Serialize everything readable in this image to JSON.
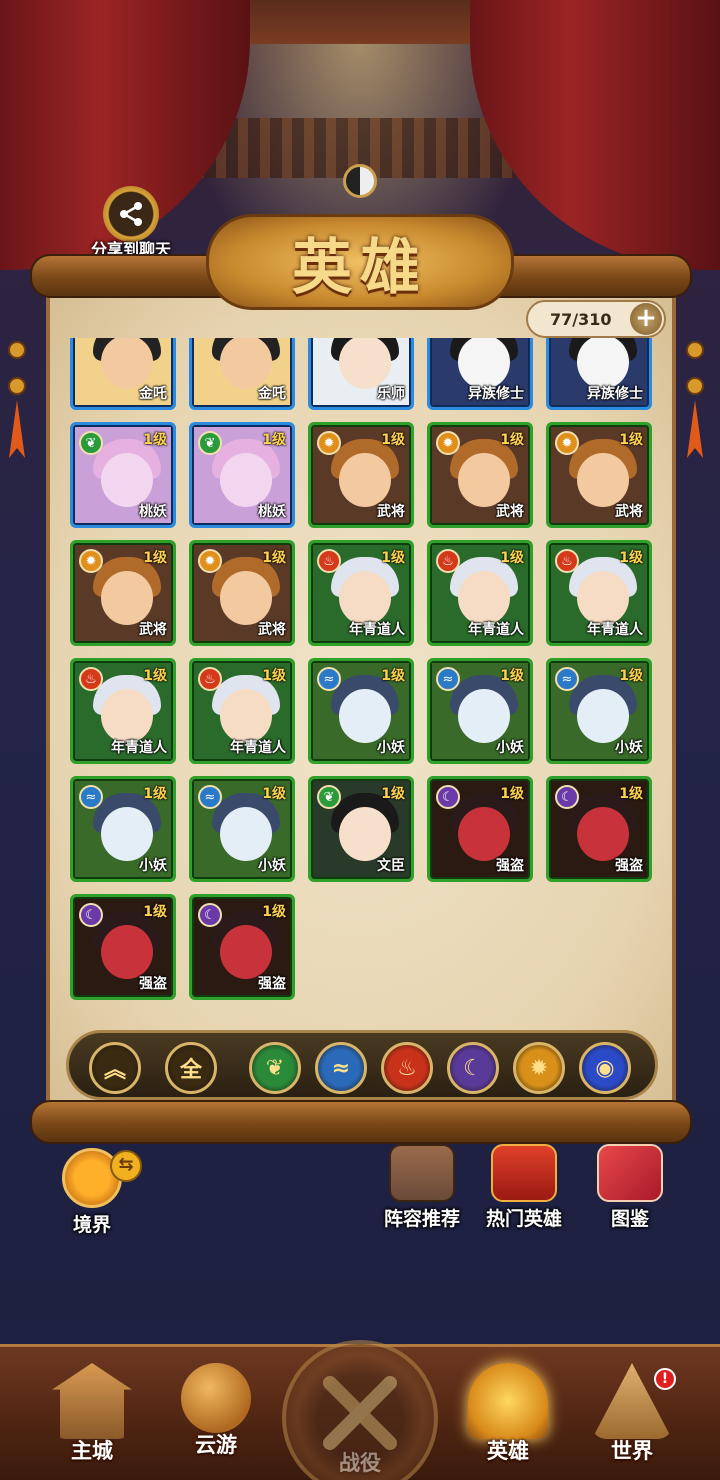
{
  "share": {
    "label": "分享到聊天"
  },
  "title": "英雄",
  "hero_count": "77/310",
  "plus_label": "+",
  "colors": {
    "green_frame": "#2fa02a",
    "blue_frame": "#2c8be0",
    "level_text": "#ffd34d"
  },
  "heroes": [
    {
      "name": "金吒",
      "level": "",
      "frame": "blue",
      "element": "none",
      "skin": "#f3c9a0",
      "hair": "#222222",
      "bg": "#f2d28a"
    },
    {
      "name": "金吒",
      "level": "",
      "frame": "blue",
      "element": "none",
      "skin": "#f3c9a0",
      "hair": "#222222",
      "bg": "#f2d28a"
    },
    {
      "name": "乐师",
      "level": "",
      "frame": "blue",
      "element": "none",
      "skin": "#f6e0cc",
      "hair": "#1a1a1a",
      "bg": "#e8eef2"
    },
    {
      "name": "异族修士",
      "level": "",
      "frame": "blue",
      "element": "none",
      "skin": "#f5f5f5",
      "hair": "#1a1a1a",
      "bg": "#2a3a6a"
    },
    {
      "name": "异族修士",
      "level": "",
      "frame": "blue",
      "element": "none",
      "skin": "#f5f5f5",
      "hair": "#1a1a1a",
      "bg": "#2a3a6a"
    },
    {
      "name": "桃妖",
      "level": "1级",
      "frame": "blue",
      "element": "wood",
      "skin": "#f2d6ef",
      "hair": "#e6b0e0",
      "bg": "#c9a0d8"
    },
    {
      "name": "桃妖",
      "level": "1级",
      "frame": "blue",
      "element": "wood",
      "skin": "#f2d6ef",
      "hair": "#e6b0e0",
      "bg": "#c9a0d8"
    },
    {
      "name": "武将",
      "level": "1级",
      "frame": "green",
      "element": "light",
      "skin": "#f3c9a0",
      "hair": "#b06a2a",
      "bg": "#5a3a26"
    },
    {
      "name": "武将",
      "level": "1级",
      "frame": "green",
      "element": "light",
      "skin": "#f3c9a0",
      "hair": "#b06a2a",
      "bg": "#5a3a26"
    },
    {
      "name": "武将",
      "level": "1级",
      "frame": "green",
      "element": "light",
      "skin": "#f3c9a0",
      "hair": "#b06a2a",
      "bg": "#5a3a26"
    },
    {
      "name": "武将",
      "level": "1级",
      "frame": "green",
      "element": "light",
      "skin": "#f3c9a0",
      "hair": "#b06a2a",
      "bg": "#5a3a26"
    },
    {
      "name": "武将",
      "level": "1级",
      "frame": "green",
      "element": "light",
      "skin": "#f3c9a0",
      "hair": "#b06a2a",
      "bg": "#5a3a26"
    },
    {
      "name": "年青道人",
      "level": "1级",
      "frame": "green",
      "element": "fire",
      "skin": "#f6dcc4",
      "hair": "#dfe4ee",
      "bg": "#2a6a2a"
    },
    {
      "name": "年青道人",
      "level": "1级",
      "frame": "green",
      "element": "fire",
      "skin": "#f6dcc4",
      "hair": "#dfe4ee",
      "bg": "#2a6a2a"
    },
    {
      "name": "年青道人",
      "level": "1级",
      "frame": "green",
      "element": "fire",
      "skin": "#f6dcc4",
      "hair": "#dfe4ee",
      "bg": "#2a6a2a"
    },
    {
      "name": "年青道人",
      "level": "1级",
      "frame": "green",
      "element": "fire",
      "skin": "#f6dcc4",
      "hair": "#dfe4ee",
      "bg": "#2a6a2a"
    },
    {
      "name": "年青道人",
      "level": "1级",
      "frame": "green",
      "element": "fire",
      "skin": "#f6dcc4",
      "hair": "#dfe4ee",
      "bg": "#2a6a2a"
    },
    {
      "name": "小妖",
      "level": "1级",
      "frame": "green",
      "element": "water",
      "skin": "#e4eef6",
      "hair": "#3a4a6a",
      "bg": "#3a6a2a"
    },
    {
      "name": "小妖",
      "level": "1级",
      "frame": "green",
      "element": "water",
      "skin": "#e4eef6",
      "hair": "#3a4a6a",
      "bg": "#3a6a2a"
    },
    {
      "name": "小妖",
      "level": "1级",
      "frame": "green",
      "element": "water",
      "skin": "#e4eef6",
      "hair": "#3a4a6a",
      "bg": "#3a6a2a"
    },
    {
      "name": "小妖",
      "level": "1级",
      "frame": "green",
      "element": "water",
      "skin": "#e4eef6",
      "hair": "#3a4a6a",
      "bg": "#3a6a2a"
    },
    {
      "name": "小妖",
      "level": "1级",
      "frame": "green",
      "element": "water",
      "skin": "#e4eef6",
      "hair": "#3a4a6a",
      "bg": "#3a6a2a"
    },
    {
      "name": "文臣",
      "level": "1级",
      "frame": "green",
      "element": "wood",
      "skin": "#f6e0cc",
      "hair": "#1a1a1a",
      "bg": "#2a3a2a"
    },
    {
      "name": "强盗",
      "level": "1级",
      "frame": "green",
      "element": "dark",
      "skin": "#c8323a",
      "hair": "#2a1a1a",
      "bg": "#2a1a12"
    },
    {
      "name": "强盗",
      "level": "1级",
      "frame": "green",
      "element": "dark",
      "skin": "#c8323a",
      "hair": "#2a1a1a",
      "bg": "#2a1a12"
    },
    {
      "name": "强盗",
      "level": "1级",
      "frame": "green",
      "element": "dark",
      "skin": "#c8323a",
      "hair": "#2a1a1a",
      "bg": "#2a1a12"
    },
    {
      "name": "强盗",
      "level": "1级",
      "frame": "green",
      "element": "dark",
      "skin": "#c8323a",
      "hair": "#2a1a1a",
      "bg": "#2a1a12"
    }
  ],
  "elements": {
    "wood": {
      "color": "#2a9a3a",
      "glyph": "❦"
    },
    "light": {
      "color": "#e0901a",
      "glyph": "✹"
    },
    "fire": {
      "color": "#d43a1a",
      "glyph": "♨"
    },
    "water": {
      "color": "#2a7ac8",
      "glyph": "≈"
    },
    "dark": {
      "color": "#6a3aa8",
      "glyph": "☾"
    },
    "none": {
      "color": "#000000",
      "glyph": ""
    }
  },
  "filters": [
    {
      "id": "collapse",
      "label": "︽",
      "color": "#3a2a12"
    },
    {
      "id": "all",
      "label": "全",
      "color": "#3a2a12"
    },
    {
      "id": "wood",
      "label": "❦",
      "color": "#2a8a3a"
    },
    {
      "id": "water",
      "label": "≈",
      "color": "#2a6ab8"
    },
    {
      "id": "fire",
      "label": "♨",
      "color": "#c8321a"
    },
    {
      "id": "dark",
      "label": "☾",
      "color": "#5a3a98"
    },
    {
      "id": "light",
      "label": "✹",
      "color": "#d8901a"
    },
    {
      "id": "storm",
      "label": "◉",
      "color": "#2a4ac8"
    }
  ],
  "features": {
    "realm": "境界",
    "lineup": "阵容推荐",
    "popular": "热门英雄",
    "codex": "图鉴"
  },
  "tabs": {
    "main_city": "主城",
    "travel": "云游",
    "battle": "战役",
    "heroes": "英雄",
    "world": "世界"
  },
  "world_badge": "!"
}
